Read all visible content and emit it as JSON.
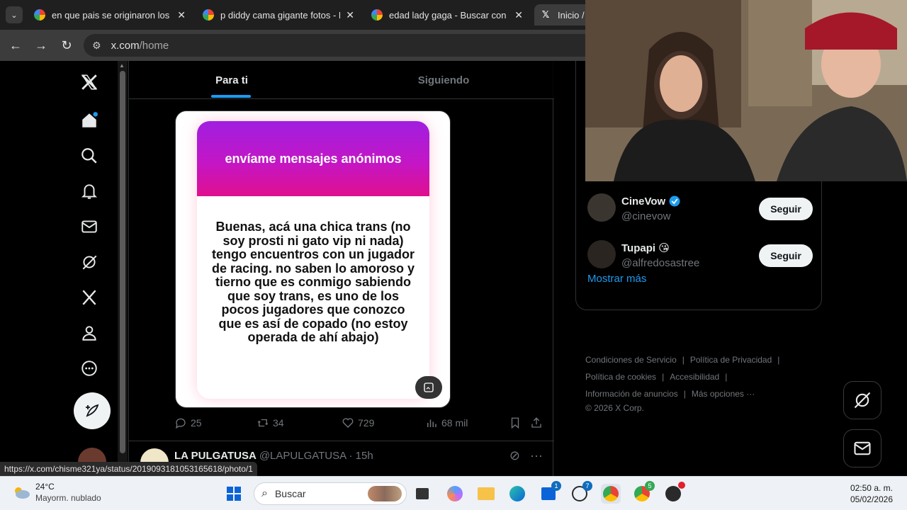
{
  "browser": {
    "tabs": [
      {
        "title": "en que pais se originaron los th",
        "active": false
      },
      {
        "title": "p diddy cama gigante fotos - Bu",
        "active": false
      },
      {
        "title": "edad lady gaga - Buscar con Go",
        "active": false
      },
      {
        "title": "Inicio /",
        "active": true
      }
    ],
    "url_host": "x.com",
    "url_path": "/home",
    "status_url": "https://x.com/chisme321ya/status/2019093181053165618/photo/1"
  },
  "timeline": {
    "tabs": [
      "Para ti",
      "Siguiendo"
    ],
    "post": {
      "card_header": "envíame mensajes anónimos",
      "card_text": "Buenas, acá una chica trans (no soy prosti ni gato vip ni nada) tengo encuentros con un jugador de racing. no saben lo amoroso y tierno que es conmigo sabiendo que soy trans, es uno de los pocos jugadores que conozco que es así de copado (no estoy operada de ahí abajo)",
      "replies": "25",
      "reposts": "34",
      "likes": "729",
      "views": "68 mil"
    },
    "next_post": {
      "name": "LA PULGATUSA",
      "handle": "@LAPULGATUSA · 15h"
    }
  },
  "who_to_follow": {
    "items": [
      {
        "name": "CineVow",
        "handle": "@cinevow",
        "verified": true,
        "button": "Seguir"
      },
      {
        "name": "Tupapi 😘",
        "handle": "@alfredosastree",
        "verified": false,
        "button": "Seguir"
      }
    ],
    "show_more": "Mostrar más"
  },
  "footer": {
    "links": [
      "Condiciones de Servicio",
      "Política de Privacidad",
      "Política de cookies",
      "Accesibilidad",
      "Información de anuncios",
      "Más opciones ···"
    ],
    "copyright": "© 2026 X Corp."
  },
  "taskbar": {
    "temp": "24°C",
    "weather": "Mayorm. nublado",
    "search_placeholder": "Buscar",
    "time": "02:50 a. m.",
    "date": "05/02/2026",
    "badges": {
      "store": "1",
      "whatsapp": "7",
      "chrome2": "5"
    }
  },
  "colors": {
    "accent": "#1d9bf0",
    "bg": "#000000",
    "card_gradient_start": "#a01fe0",
    "card_gradient_end": "#e0108e"
  }
}
